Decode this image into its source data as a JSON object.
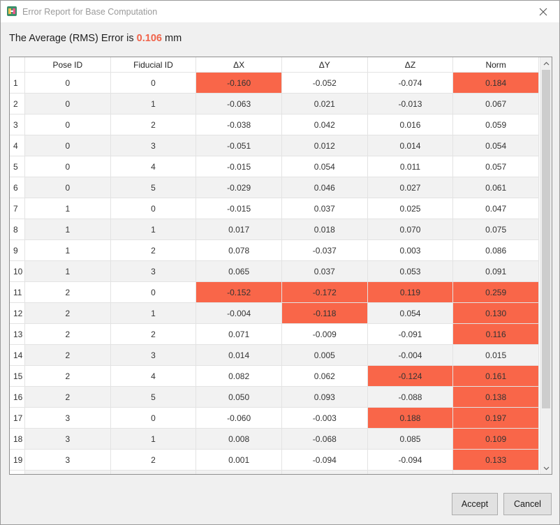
{
  "window": {
    "title": "Error Report for Base Computation",
    "icon": "app-icon",
    "close_icon": "close-icon"
  },
  "summary": {
    "prefix": "The Average (RMS) Error is",
    "value": "0.106",
    "unit": "mm",
    "value_color": "#f0634a"
  },
  "table": {
    "highlight_color": "#f96649",
    "columns": [
      "Pose ID",
      "Fiducial ID",
      "ΔX",
      "ΔY",
      "ΔZ",
      "Norm"
    ],
    "rows": [
      {
        "index": "1",
        "pose": "0",
        "fid": "0",
        "dx": "-0.160",
        "dy": "-0.052",
        "dz": "-0.074",
        "norm": "0.184",
        "hl": [
          "dx",
          "norm"
        ]
      },
      {
        "index": "2",
        "pose": "0",
        "fid": "1",
        "dx": "-0.063",
        "dy": "0.021",
        "dz": "-0.013",
        "norm": "0.067",
        "hl": []
      },
      {
        "index": "3",
        "pose": "0",
        "fid": "2",
        "dx": "-0.038",
        "dy": "0.042",
        "dz": "0.016",
        "norm": "0.059",
        "hl": []
      },
      {
        "index": "4",
        "pose": "0",
        "fid": "3",
        "dx": "-0.051",
        "dy": "0.012",
        "dz": "0.014",
        "norm": "0.054",
        "hl": []
      },
      {
        "index": "5",
        "pose": "0",
        "fid": "4",
        "dx": "-0.015",
        "dy": "0.054",
        "dz": "0.011",
        "norm": "0.057",
        "hl": []
      },
      {
        "index": "6",
        "pose": "0",
        "fid": "5",
        "dx": "-0.029",
        "dy": "0.046",
        "dz": "0.027",
        "norm": "0.061",
        "hl": []
      },
      {
        "index": "7",
        "pose": "1",
        "fid": "0",
        "dx": "-0.015",
        "dy": "0.037",
        "dz": "0.025",
        "norm": "0.047",
        "hl": []
      },
      {
        "index": "8",
        "pose": "1",
        "fid": "1",
        "dx": "0.017",
        "dy": "0.018",
        "dz": "0.070",
        "norm": "0.075",
        "hl": []
      },
      {
        "index": "9",
        "pose": "1",
        "fid": "2",
        "dx": "0.078",
        "dy": "-0.037",
        "dz": "0.003",
        "norm": "0.086",
        "hl": []
      },
      {
        "index": "10",
        "pose": "1",
        "fid": "3",
        "dx": "0.065",
        "dy": "0.037",
        "dz": "0.053",
        "norm": "0.091",
        "hl": []
      },
      {
        "index": "11",
        "pose": "2",
        "fid": "0",
        "dx": "-0.152",
        "dy": "-0.172",
        "dz": "0.119",
        "norm": "0.259",
        "hl": [
          "dx",
          "dy",
          "dz",
          "norm"
        ]
      },
      {
        "index": "12",
        "pose": "2",
        "fid": "1",
        "dx": "-0.004",
        "dy": "-0.118",
        "dz": "0.054",
        "norm": "0.130",
        "hl": [
          "dy",
          "norm"
        ]
      },
      {
        "index": "13",
        "pose": "2",
        "fid": "2",
        "dx": "0.071",
        "dy": "-0.009",
        "dz": "-0.091",
        "norm": "0.116",
        "hl": [
          "norm"
        ]
      },
      {
        "index": "14",
        "pose": "2",
        "fid": "3",
        "dx": "0.014",
        "dy": "0.005",
        "dz": "-0.004",
        "norm": "0.015",
        "hl": []
      },
      {
        "index": "15",
        "pose": "2",
        "fid": "4",
        "dx": "0.082",
        "dy": "0.062",
        "dz": "-0.124",
        "norm": "0.161",
        "hl": [
          "dz",
          "norm"
        ]
      },
      {
        "index": "16",
        "pose": "2",
        "fid": "5",
        "dx": "0.050",
        "dy": "0.093",
        "dz": "-0.088",
        "norm": "0.138",
        "hl": [
          "norm"
        ]
      },
      {
        "index": "17",
        "pose": "3",
        "fid": "0",
        "dx": "-0.060",
        "dy": "-0.003",
        "dz": "0.188",
        "norm": "0.197",
        "hl": [
          "dz",
          "norm"
        ]
      },
      {
        "index": "18",
        "pose": "3",
        "fid": "1",
        "dx": "0.008",
        "dy": "-0.068",
        "dz": "0.085",
        "norm": "0.109",
        "hl": [
          "norm"
        ]
      },
      {
        "index": "19",
        "pose": "3",
        "fid": "2",
        "dx": "0.001",
        "dy": "-0.094",
        "dz": "-0.094",
        "norm": "0.133",
        "hl": [
          "norm"
        ]
      }
    ]
  },
  "buttons": {
    "accept": "Accept",
    "cancel": "Cancel"
  },
  "icons": {
    "scroll_up": "chevron-up-icon",
    "scroll_down": "chevron-down-icon"
  }
}
